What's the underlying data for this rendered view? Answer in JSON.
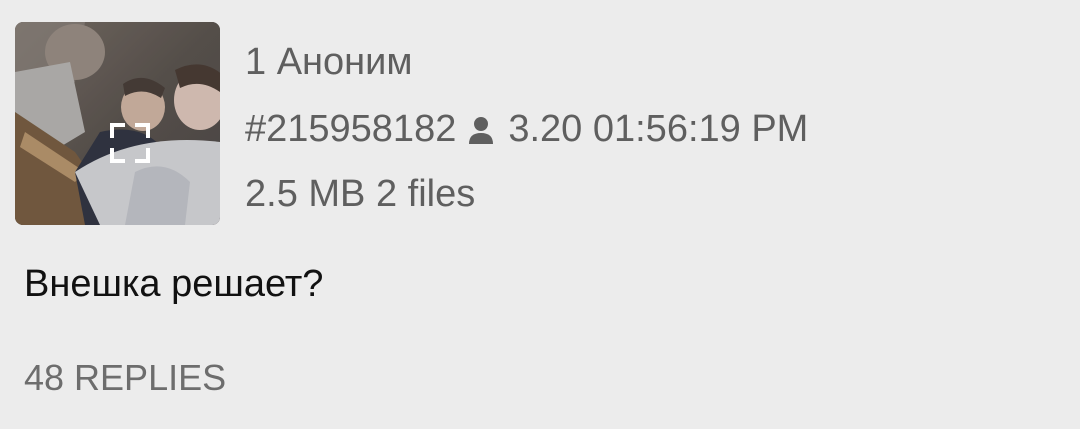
{
  "post": {
    "number": "1",
    "author": "Аноним",
    "post_id": "#215958182",
    "timestamp": "3.20 01:56:19 PM",
    "file_size": "2.5 MB",
    "file_count": "2 files",
    "message": "Внешка решает?",
    "replies": "48 REPLIES"
  },
  "icons": {
    "thumbnail_overlay": "expand-icon",
    "poster": "person-icon"
  },
  "colors": {
    "background": "#ececec",
    "meta_text": "#5f5f5f",
    "message_text": "#111111",
    "replies_text": "#6d6d6d"
  }
}
